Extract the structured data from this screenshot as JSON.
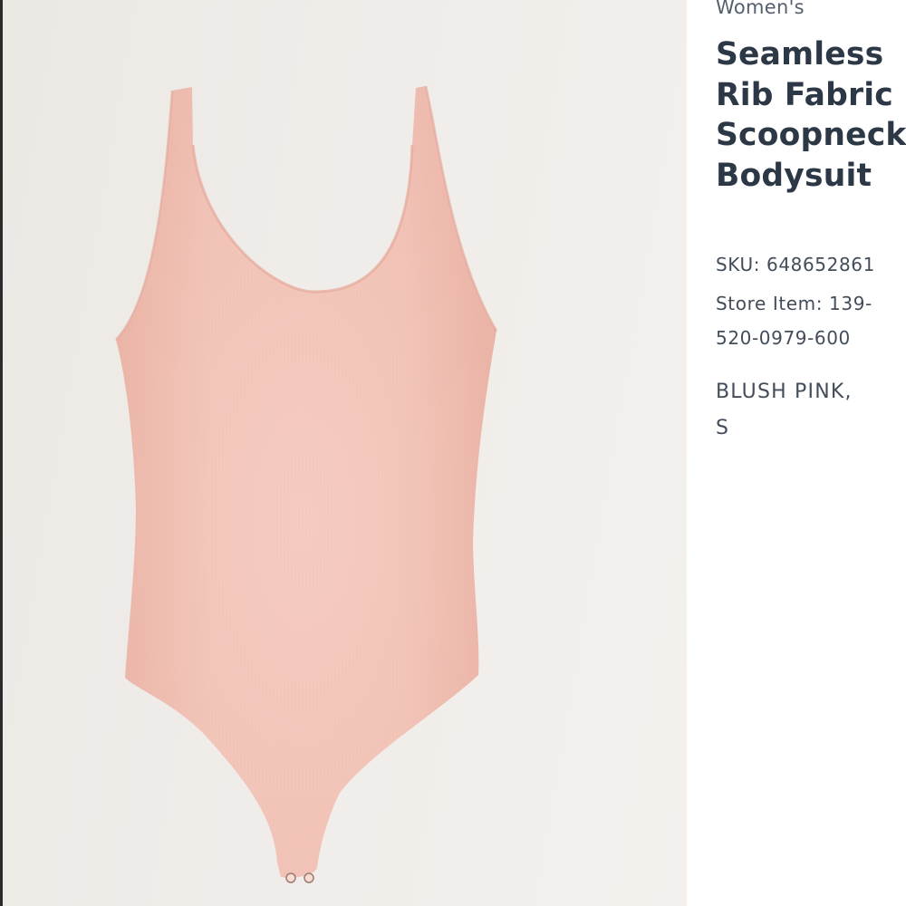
{
  "product": {
    "gender": "Women's",
    "title_lines": [
      "Seamless",
      "Rib Fabric",
      "Scoopneck",
      "Bodysuit"
    ],
    "sku": "SKU: 648652861",
    "store_item_lines": [
      "Store Item: 139-",
      "520-0979-600"
    ],
    "variant_lines": [
      "BLUSH PINK,",
      "S"
    ],
    "image": {
      "subject": "blush pink scoopneck bodysuit",
      "garment_color": "#f4c4b8",
      "background_color": "#efebe7"
    }
  }
}
